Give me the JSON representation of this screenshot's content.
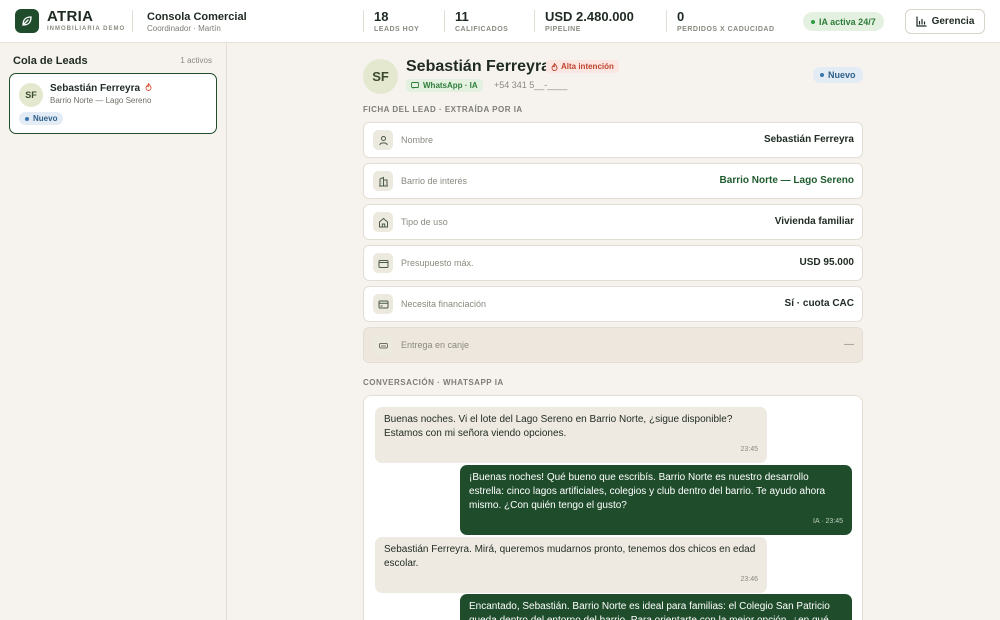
{
  "header": {
    "brand_name": "ATRIA",
    "brand_sub": "INMOBILIARIA DEMO",
    "console_title": "Consola Comercial",
    "console_sub": "Coordinador · Martín",
    "stats": [
      {
        "value": "18",
        "label": "LEADS HOY"
      },
      {
        "value": "11",
        "label": "CALIFICADOS"
      },
      {
        "value": "USD 2.480.000",
        "label": "PIPELINE"
      },
      {
        "value": "0",
        "label": "PERDIDOS X CADUCIDAD"
      }
    ],
    "ia_status": "IA activa 24/7",
    "gerencia_label": "Gerencia"
  },
  "sidebar": {
    "title": "Cola de Leads",
    "count": "1 activos",
    "leads": [
      {
        "initials": "SF",
        "name": "Sebastián Ferreyra",
        "subtitle": "Barrio Norte — Lago Sereno",
        "status": "Nuevo"
      }
    ]
  },
  "lead": {
    "initials": "SF",
    "name": "Sebastián Ferreyra",
    "intent": "Alta intención",
    "channel": "WhatsApp · IA",
    "phone": "+54 341 5__-____",
    "status": "Nuevo"
  },
  "sheet": {
    "title": "FICHA DEL LEAD · EXTRAÍDA POR IA",
    "fields": [
      {
        "label": "Nombre",
        "value": "Sebastián Ferreyra",
        "icon": "person-icon"
      },
      {
        "label": "Barrio de interés",
        "value": "Barrio Norte — Lago Sereno",
        "icon": "building-icon"
      },
      {
        "label": "Tipo de uso",
        "value": "Vivienda familiar",
        "icon": "home-icon"
      },
      {
        "label": "Presupuesto máx.",
        "value": "USD 95.000",
        "icon": "wallet-icon"
      },
      {
        "label": "Necesita financiación",
        "value": "Sí · cuota CAC",
        "icon": "card-icon"
      },
      {
        "label": "Entrega en canje",
        "value": "—",
        "icon": "car-icon"
      }
    ]
  },
  "conversation": {
    "title": "CONVERSACIÓN · WHATSAPP IA",
    "messages": [
      {
        "dir": "in",
        "text": "Buenas noches. Vi el lote del Lago Sereno en Barrio Norte, ¿sigue disponible? Estamos con mi señora viendo opciones.",
        "time": "23:45"
      },
      {
        "dir": "out",
        "text": "¡Buenas noches! Qué bueno que escribís. Barrio Norte es nuestro desarrollo estrella: cinco lagos artificiales, colegios y club dentro del barrio. Te ayudo ahora mismo. ¿Con quién tengo el gusto?",
        "time": "IA · 23:45"
      },
      {
        "dir": "in",
        "text": "Sebastián Ferreyra. Mirá, queremos mudarnos pronto, tenemos dos chicos en edad escolar.",
        "time": "23:46"
      },
      {
        "dir": "out",
        "text": "Encantado, Sebastián. Barrio Norte es ideal para familias: el Colegio San Patricio queda dentro del entorno del barrio. Para orientarte con la mejor opción, ¿en qué",
        "time": ""
      }
    ]
  },
  "colors": {
    "brand": "#1f4d2c",
    "accent_green": "#2e7d3a",
    "alert": "#c0432e",
    "info": "#2f5f8a"
  }
}
